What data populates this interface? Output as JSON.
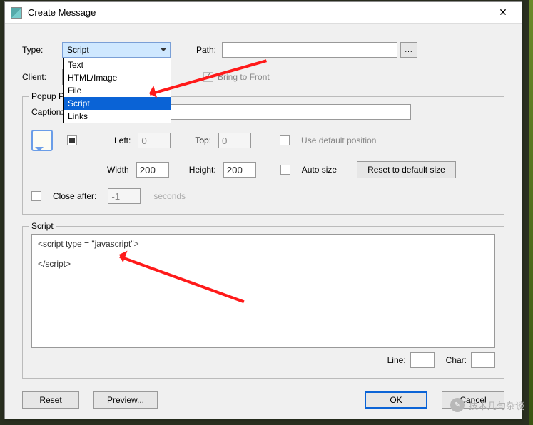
{
  "title": "Create Message",
  "labels": {
    "type": "Type:",
    "path": "Path:",
    "client": "Client:",
    "bring_front": "Bring to Front",
    "popup_legend": "Popup Position",
    "caption": "Caption:",
    "left": "Left:",
    "top": "Top:",
    "use_default_pos": "Use default position",
    "width": "Width",
    "height": "Height:",
    "auto_size": "Auto size",
    "reset_size": "Reset to default size",
    "close_after": "Close after:",
    "seconds": "seconds",
    "script_legend": "Script",
    "line": "Line:",
    "char": "Char:",
    "reset": "Reset",
    "preview": "Preview...",
    "ok": "OK",
    "cancel": "Cancel",
    "ellipsis": "..."
  },
  "dropdown": {
    "selected": "Script",
    "options": [
      "Text",
      "HTML/Image",
      "File",
      "Script",
      "Links"
    ]
  },
  "values": {
    "left": "0",
    "top": "0",
    "width": "200",
    "height": "200",
    "close_after": "-1",
    "line": "",
    "char": ""
  },
  "script_lines": [
    "<script type = \"javascript\">",
    "</script>"
  ],
  "watermark": "技术几句杂谈"
}
